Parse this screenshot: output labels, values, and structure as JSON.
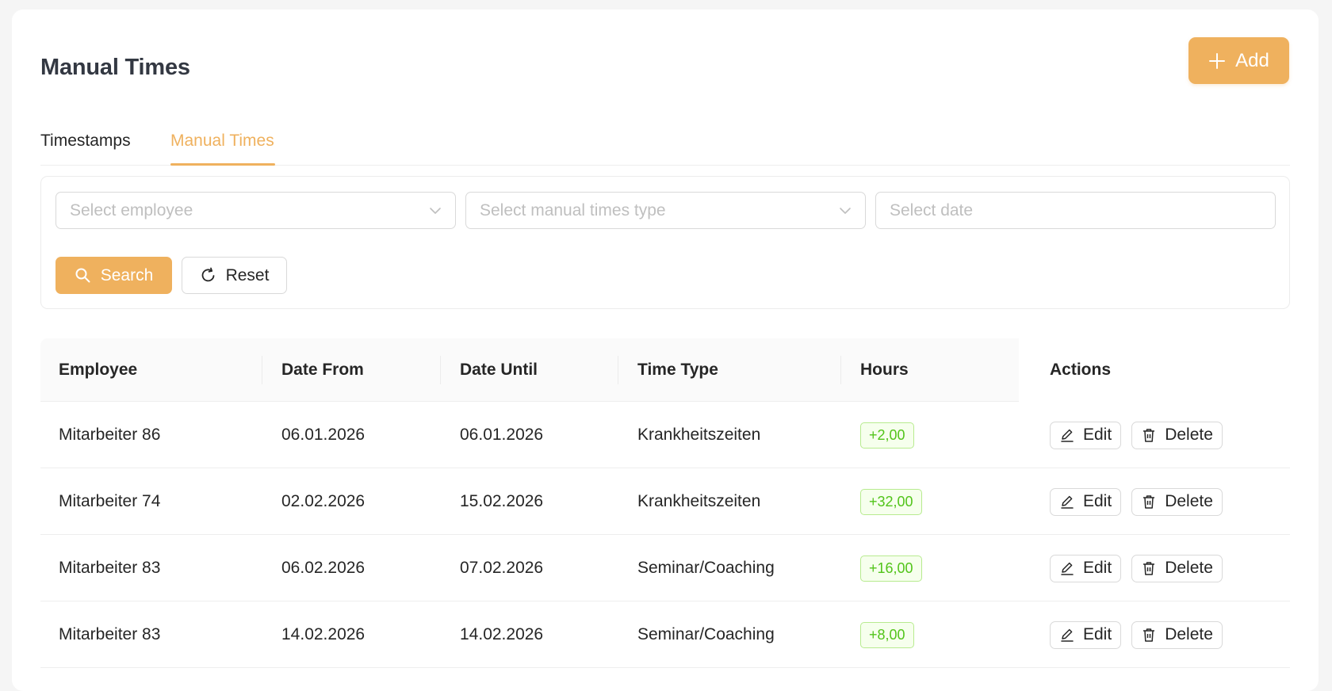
{
  "header": {
    "title": "Manual Times",
    "add_label": "Add"
  },
  "tabs": [
    {
      "label": "Timestamps",
      "active": false
    },
    {
      "label": "Manual Times",
      "active": true
    }
  ],
  "filters": {
    "employee_placeholder": "Select employee",
    "type_placeholder": "Select manual times type",
    "date_placeholder": "Select date",
    "search_label": "Search",
    "reset_label": "Reset"
  },
  "table": {
    "columns": [
      "Employee",
      "Date From",
      "Date Until",
      "Time Type",
      "Hours",
      "Actions"
    ],
    "edit_label": "Edit",
    "delete_label": "Delete",
    "rows": [
      {
        "employee": "Mitarbeiter 86",
        "date_from": "06.01.2026",
        "date_until": "06.01.2026",
        "time_type": "Krankheitszeiten",
        "hours": "+2,00"
      },
      {
        "employee": "Mitarbeiter 74",
        "date_from": "02.02.2026",
        "date_until": "15.02.2026",
        "time_type": "Krankheitszeiten",
        "hours": "+32,00"
      },
      {
        "employee": "Mitarbeiter 83",
        "date_from": "06.02.2026",
        "date_until": "07.02.2026",
        "time_type": "Seminar/Coaching",
        "hours": "+16,00"
      },
      {
        "employee": "Mitarbeiter 83",
        "date_from": "14.02.2026",
        "date_until": "14.02.2026",
        "time_type": "Seminar/Coaching",
        "hours": "+8,00"
      }
    ]
  },
  "colors": {
    "accent": "#efb15e",
    "success_text": "#52c41a",
    "success_border": "#b7eb8f",
    "success_bg": "#f6ffed"
  },
  "icons": [
    "plus-icon",
    "chevron-down-icon",
    "search-icon",
    "reload-icon",
    "edit-icon",
    "delete-icon"
  ]
}
